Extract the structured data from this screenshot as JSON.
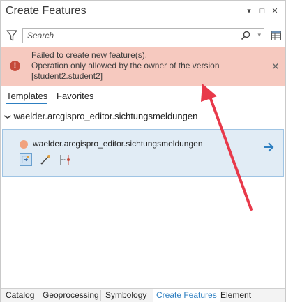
{
  "window": {
    "title": "Create Features",
    "controls": {
      "menu": "▾",
      "pin": "□",
      "close": "✕"
    }
  },
  "search": {
    "placeholder": "Search",
    "dropdown": "▾"
  },
  "error": {
    "icon": "!",
    "lines": [
      "Failed to create new feature(s).",
      "Operation only allowed by the owner of the version",
      "[student2.student2]"
    ],
    "close": "✕",
    "color": "#f6c9bf"
  },
  "tabs": [
    {
      "label": "Templates",
      "active": true
    },
    {
      "label": "Favorites",
      "active": false
    }
  ],
  "layer": {
    "chevron": "❯",
    "name": "waelder.arcgispro_editor.sichtungsmeldungen"
  },
  "template": {
    "label": "waelder.arcgispro_editor.sichtungsmeldungen",
    "swatch_color": "#f1a27e",
    "tools": [
      "point-tool-icon",
      "line-tool-icon",
      "point-at-end-of-line-tool-icon"
    ]
  },
  "bottom_tabs": [
    {
      "label": "Catalog",
      "active": false
    },
    {
      "label": "Geoprocessing",
      "active": false
    },
    {
      "label": "Symbology",
      "active": false
    },
    {
      "label": "Create Features",
      "active": true
    },
    {
      "label": "Element",
      "active": false
    }
  ],
  "colors": {
    "accent": "#2d7fc1",
    "annotation_arrow": "#e8394a"
  }
}
